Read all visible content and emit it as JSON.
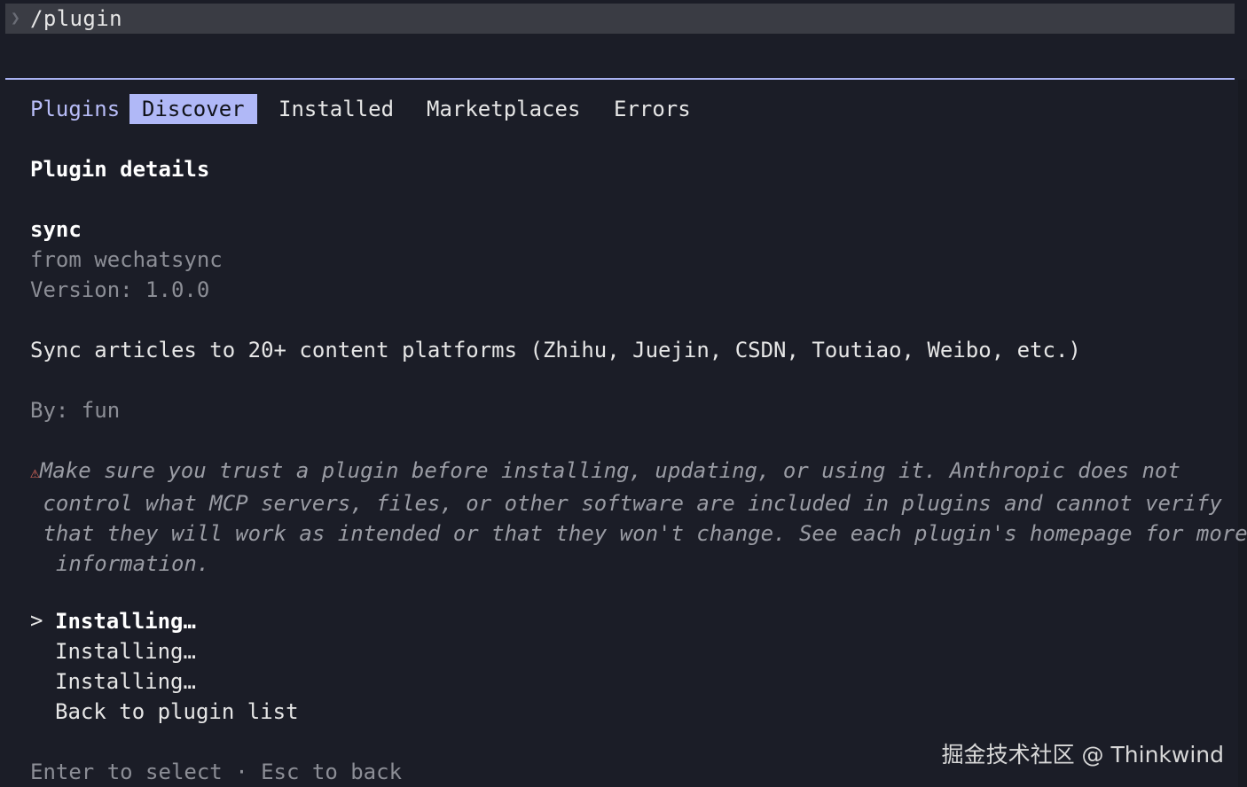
{
  "command_bar": {
    "prompt_icon": "chevron-right-icon",
    "text": "/plugin"
  },
  "tabs": {
    "title": "Plugins",
    "items": [
      {
        "label": "Discover",
        "active": true
      },
      {
        "label": "Installed",
        "active": false
      },
      {
        "label": "Marketplaces",
        "active": false
      },
      {
        "label": "Errors",
        "active": false
      }
    ]
  },
  "details": {
    "heading": "Plugin details",
    "name": "sync",
    "source": "from wechatsync",
    "version": "Version: 1.0.0",
    "description": "Sync articles to 20+ content platforms (Zhihu, Juejin, CSDN, Toutiao, Weibo, etc.)",
    "author": "By: fun"
  },
  "warning": {
    "icon": "warning-triangle-icon",
    "icon_glyph": "⚠",
    "lines": [
      "Make sure you trust a plugin before installing, updating, or using it. Anthropic does not",
      " control what MCP servers, files, or other software are included in plugins and cannot verify",
      " that they will work as intended or that they won't change. See each plugin's homepage for more",
      "  information."
    ]
  },
  "menu": {
    "caret": ">",
    "items": [
      {
        "label": "Installing…",
        "selected": true
      },
      {
        "label": "Installing…",
        "selected": false
      },
      {
        "label": "Installing…",
        "selected": false
      },
      {
        "label": "Back to plugin list",
        "selected": false
      }
    ]
  },
  "footer": {
    "hint": "Enter to select · Esc to back"
  },
  "watermark": {
    "text": "掘金技术社区 @ Thinkwind"
  },
  "colors": {
    "background": "#1b1d27",
    "accent": "#b0b8f7",
    "warning_icon": "#e06a5c"
  }
}
